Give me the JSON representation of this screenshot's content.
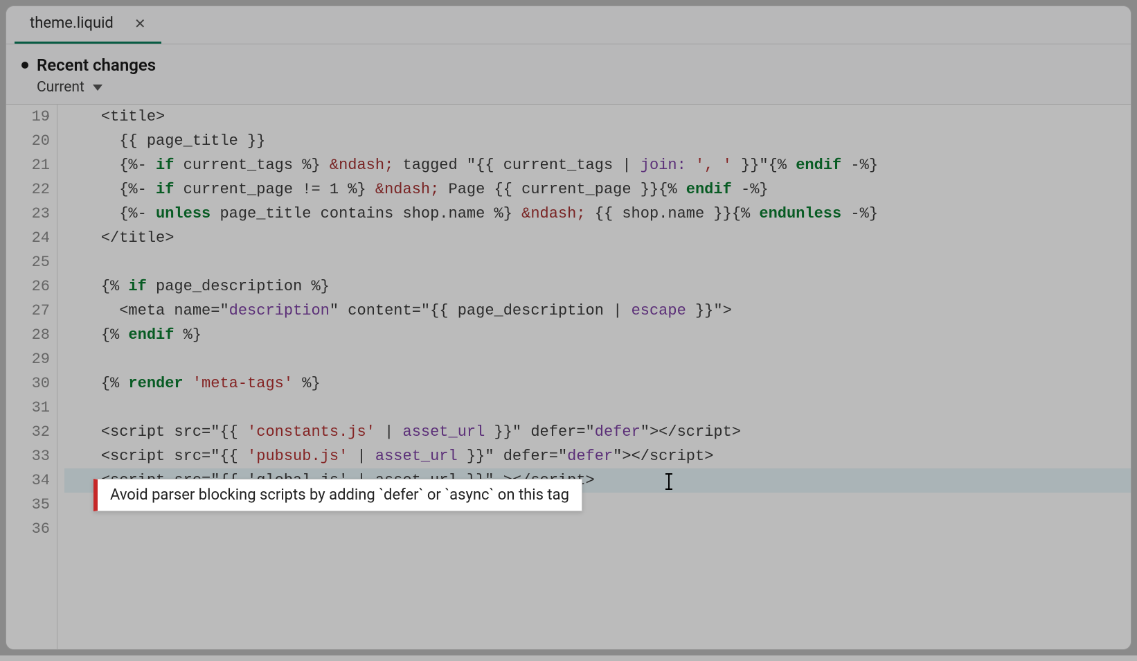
{
  "tab": {
    "label": "theme.liquid"
  },
  "header": {
    "recent_changes": "Recent changes",
    "version": "Current"
  },
  "gutter": [
    "19",
    "20",
    "21",
    "22",
    "23",
    "24",
    "25",
    "26",
    "27",
    "28",
    "29",
    "30",
    "31",
    "32",
    "33",
    "34",
    "35",
    "36"
  ],
  "code": {
    "l19": {
      "indent": "    ",
      "a": "<title>"
    },
    "l20": {
      "indent": "      ",
      "a": "{{ page_title }}"
    },
    "l21": {
      "indent": "      ",
      "open": "{%- ",
      "kw": "if",
      "mid1": " current_tags %} ",
      "ent": "&ndash;",
      "mid2": " tagged \"{{ current_tags | ",
      "filt": "join:",
      "mid3": " ",
      "str": "', '",
      "mid4": " }}\"{% ",
      "kw2": "endif",
      "close": " -%}"
    },
    "l22": {
      "indent": "      ",
      "open": "{%- ",
      "kw": "if",
      "mid1": " current_page != 1 %} ",
      "ent": "&ndash;",
      "mid2": " Page {{ current_page }}{% ",
      "kw2": "endif",
      "close": " -%}"
    },
    "l23": {
      "indent": "      ",
      "open": "{%- ",
      "kw": "unless",
      "mid1": " page_title contains shop.name %} ",
      "ent": "&ndash;",
      "mid2": " {{ shop.name }}{% ",
      "kw2": "endunless",
      "close": " -%}"
    },
    "l24": {
      "indent": "    ",
      "a": "</title>"
    },
    "l25": {
      "a": ""
    },
    "l26": {
      "indent": "    ",
      "open": "{% ",
      "kw": "if",
      "mid": " page_description %}"
    },
    "l27": {
      "indent": "      ",
      "a": "<meta name=\"",
      "attr1": "description",
      "b": "\" content=\"{{ page_description | ",
      "filt": "escape",
      "c": " }}\">"
    },
    "l28": {
      "indent": "    ",
      "open": "{% ",
      "kw": "endif",
      "close": " %}"
    },
    "l29": {
      "a": ""
    },
    "l30": {
      "indent": "    ",
      "open": "{% ",
      "kw": "render",
      "sp": " ",
      "str": "'meta-tags'",
      "close": " %}"
    },
    "l31": {
      "a": ""
    },
    "l32": {
      "indent": "    ",
      "a": "<script src=\"{{ ",
      "str": "'constants.js'",
      "b": " | ",
      "filt": "asset_url",
      "c": " }}\" defer=\"",
      "attr1": "defer",
      "d": "\"></script>"
    },
    "l33": {
      "indent": "    ",
      "a": "<script src=\"{{ ",
      "str": "'pubsub.js'",
      "b": " | ",
      "filt": "asset_url",
      "c": " }}\" defer=\"",
      "attr1": "defer",
      "d": "\"></script>"
    },
    "l34": {
      "indent": "    ",
      "err": "<script src=\"{{ 'global.js' | asset_url }}\" >",
      "tail": "</script>"
    },
    "l35": {
      "a": ""
    },
    "l36": {
      "a": ""
    }
  },
  "tooltip": "Avoid parser blocking scripts by adding `defer` or `async` on this tag"
}
